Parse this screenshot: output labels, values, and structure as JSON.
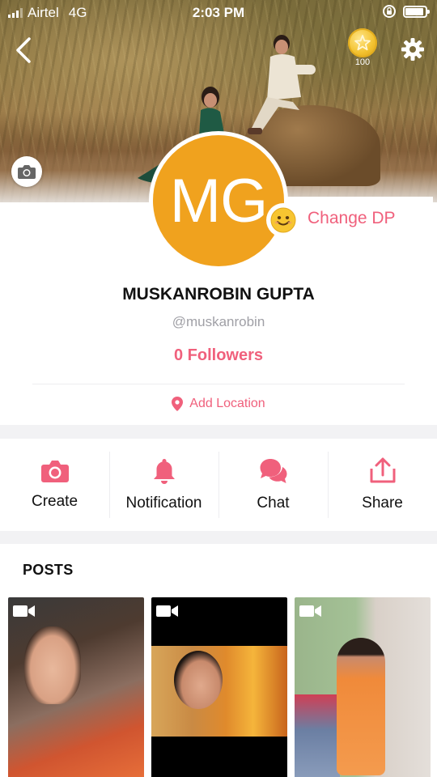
{
  "status_bar": {
    "carrier": "Airtel",
    "network": "4G",
    "time": "2:03 PM"
  },
  "header": {
    "coin_count": "100"
  },
  "profile": {
    "avatar_initials": "MG",
    "change_dp_label": "Change DP",
    "name": "MUSKANROBIN GUPTA",
    "handle": "@muskanrobin",
    "followers": "0 Followers",
    "location_label": "Add Location"
  },
  "actions": [
    {
      "label": "Create",
      "icon": "camera-icon"
    },
    {
      "label": "Notification",
      "icon": "bell-icon"
    },
    {
      "label": "Chat",
      "icon": "chat-bubbles-icon"
    },
    {
      "label": "Share",
      "icon": "share-icon"
    }
  ],
  "posts": {
    "title": "POSTS"
  },
  "colors": {
    "accent": "#f0607c",
    "avatar_bg": "#f0a21e"
  }
}
